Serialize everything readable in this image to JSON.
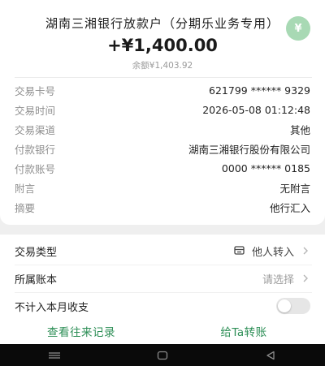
{
  "header": {
    "payer": "湖南三湘银行放款户（分期乐业务专用）",
    "badge_icon": "yen-icon",
    "badge_symbol": "¥",
    "amount": "+¥1,400.00",
    "balance": "余额¥1,403.92"
  },
  "details": [
    {
      "label": "交易卡号",
      "value": "621799 ****** 9329"
    },
    {
      "label": "交易时间",
      "value": "2026-05-08 01:12:48"
    },
    {
      "label": "交易渠道",
      "value": "其他"
    },
    {
      "label": "付款银行",
      "value": "湖南三湘银行股份有限公司"
    },
    {
      "label": "付款账号",
      "value": "0000 ****** 0185"
    },
    {
      "label": "附言",
      "value": "无附言"
    },
    {
      "label": "摘要",
      "value": "他行汇入"
    }
  ],
  "settings": {
    "type_label": "交易类型",
    "type_value": "他人转入",
    "account_label": "所属账本",
    "account_value": "请选择",
    "exclude_label": "不计入本月收支",
    "exclude_enabled": false
  },
  "actions": {
    "history": "查看往来记录",
    "transfer": "给Ta转账"
  },
  "colors": {
    "accent": "#2e8f57",
    "badge": "#a8d9b4"
  }
}
